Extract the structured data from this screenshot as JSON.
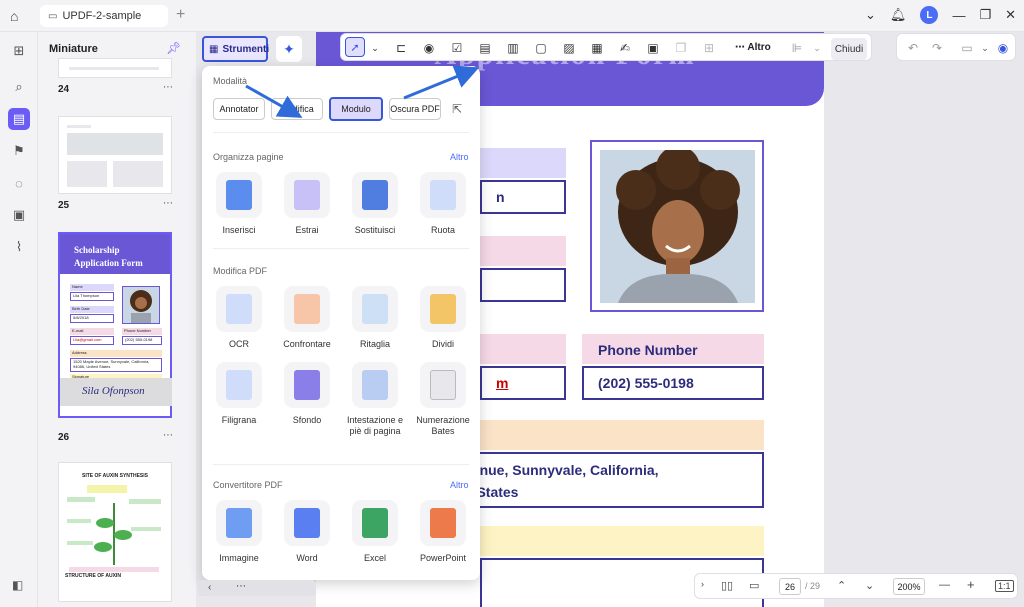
{
  "titlebar": {
    "tab_title": "UPDF-2-sample",
    "avatar_letter": "L"
  },
  "thumbs": {
    "title": "Miniature",
    "pages": [
      "24",
      "25",
      "26"
    ],
    "scholarship": {
      "line1": "Scholarship",
      "line2": "Application Form",
      "name_label": "Name",
      "name_value": "Lila Thompson",
      "birth_label": "Birth Date",
      "birth_value": "5/8/2018",
      "email_label": "E-mail",
      "email_value": "Lila@gmail.com",
      "phone_label": "Phone Number",
      "phone_value": "(202) 555-0198",
      "address_label": "Address",
      "address_value": "1520 Maple Avenue, Sunnyvale, California, 94086, United States",
      "signature_label": "Signature",
      "signature_value": "Sila Ofonpson"
    },
    "auxin_title": "SITE OF AUXIN SYNTHESIS",
    "auxin_sub": "STRUCTURE OF AUXIN"
  },
  "toolbar": {
    "strumenti": "Strumenti",
    "altro": "Altro",
    "chiudi": "Chiudi"
  },
  "panel": {
    "modalita_title": "Modalità",
    "modes": [
      "Annotator",
      "Modifica",
      "Modulo",
      "Oscura PDF"
    ],
    "organizza_title": "Organizza pagine",
    "organizza_more": "Altro",
    "organizza_tools": [
      "Inserisci",
      "Estrai",
      "Sostituisci",
      "Ruota"
    ],
    "modifica_title": "Modifica PDF",
    "modifica_tools": [
      "OCR",
      "Confrontare",
      "Ritaglia",
      "Dividi",
      "Filigrana",
      "Sfondo",
      "Intestazione e piè di pagina",
      "Numerazione Bates"
    ],
    "convert_title": "Convertitore PDF",
    "convert_more": "Altro",
    "convert_tools": [
      "Immagine",
      "Word",
      "Excel",
      "PowerPoint"
    ]
  },
  "document": {
    "header_text": "Application Form",
    "name_value": "n",
    "email_value": "m",
    "phone_label": "Phone Number",
    "phone_value": "(202) 555-0198",
    "address_line1": "venue, Sunnyvale, California,",
    "address_line2": "d States"
  },
  "bottombar": {
    "page_current": "26",
    "page_total": "/ 29",
    "zoom": "200%"
  },
  "colors": {
    "accent": "#6b5cf6",
    "header_purple": "#6a57d6",
    "highlight_blue": "#3856d9",
    "lavender_bar": "#dcd8fc",
    "pink_bar": "#f5d9e6",
    "peach_bar": "#fbe3c8",
    "yellow_bar": "#fdf3c4"
  },
  "icons": {
    "home": "home-icon",
    "bell": "bell-icon",
    "pin": "pin-icon",
    "select": "cursor-icon"
  }
}
